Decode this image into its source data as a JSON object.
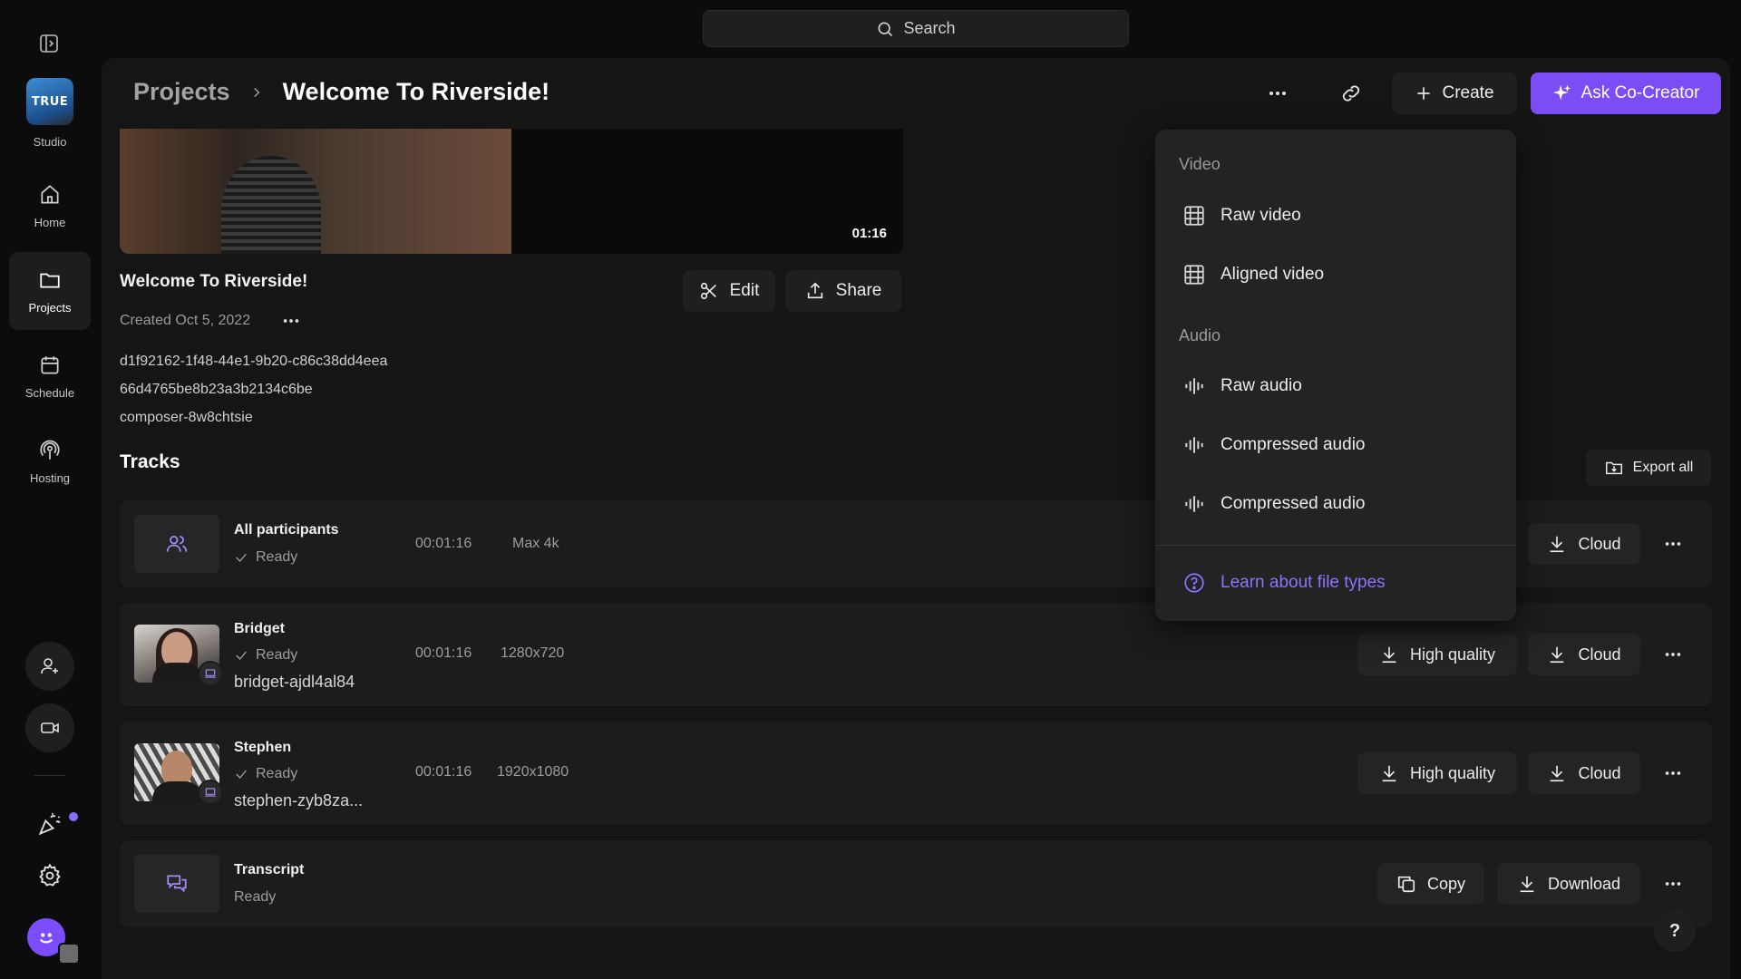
{
  "search": {
    "label": "Search"
  },
  "sidebar": {
    "studio_label": "Studio",
    "studio_logo_text": "TRUE",
    "items": [
      {
        "label": "Home",
        "icon": "home-icon"
      },
      {
        "label": "Projects",
        "icon": "folder-icon",
        "active": true
      },
      {
        "label": "Schedule",
        "icon": "calendar-icon"
      },
      {
        "label": "Hosting",
        "icon": "podcast-icon"
      }
    ],
    "bottom_icons": [
      "add-user-icon",
      "video-camera-icon",
      "party-popper-icon",
      "gear-icon",
      "avatar"
    ]
  },
  "header": {
    "breadcrumb_root": "Projects",
    "breadcrumb_current": "Welcome To Riverside!",
    "create_label": "Create",
    "cocreator_label": "Ask Co-Creator"
  },
  "project": {
    "title": "Welcome To Riverside!",
    "created": "Created Oct 5, 2022",
    "duration": "01:16",
    "meta": [
      "d1f92162-1f48-44e1-9b20-c86c38dd4eea",
      "66d4765be8b23a3b2134c6be",
      "composer-8w8chtsie"
    ],
    "edit_label": "Edit",
    "share_label": "Share"
  },
  "tracks": {
    "heading": "Tracks",
    "export_label": "Export all",
    "rows": [
      {
        "name": "All participants",
        "status": "Ready",
        "duration": "00:01:16",
        "resolution": "Max 4k",
        "buttons": [
          "Cloud"
        ]
      },
      {
        "name": "Bridget",
        "status": "Ready",
        "sub": "bridget-ajdl4al84",
        "duration": "00:01:16",
        "resolution": "1280x720",
        "buttons": [
          "High quality",
          "Cloud"
        ]
      },
      {
        "name": "Stephen",
        "status": "Ready",
        "sub": "stephen-zyb8za...",
        "duration": "00:01:16",
        "resolution": "1920x1080",
        "buttons": [
          "High quality",
          "Cloud"
        ]
      },
      {
        "name": "Transcript",
        "status": "Ready",
        "buttons": [
          "Copy",
          "Download"
        ]
      }
    ]
  },
  "dropdown": {
    "video_heading": "Video",
    "video_items": [
      "Raw video",
      "Aligned video"
    ],
    "audio_heading": "Audio",
    "audio_items": [
      "Raw audio",
      "Compressed audio",
      "Compressed audio"
    ],
    "learn_label": "Learn about file types"
  },
  "help": {
    "label": "?"
  },
  "colors": {
    "accent": "#7a4df5",
    "link": "#8f73ff",
    "background": "#0c0c0c",
    "panel": "#151515"
  }
}
